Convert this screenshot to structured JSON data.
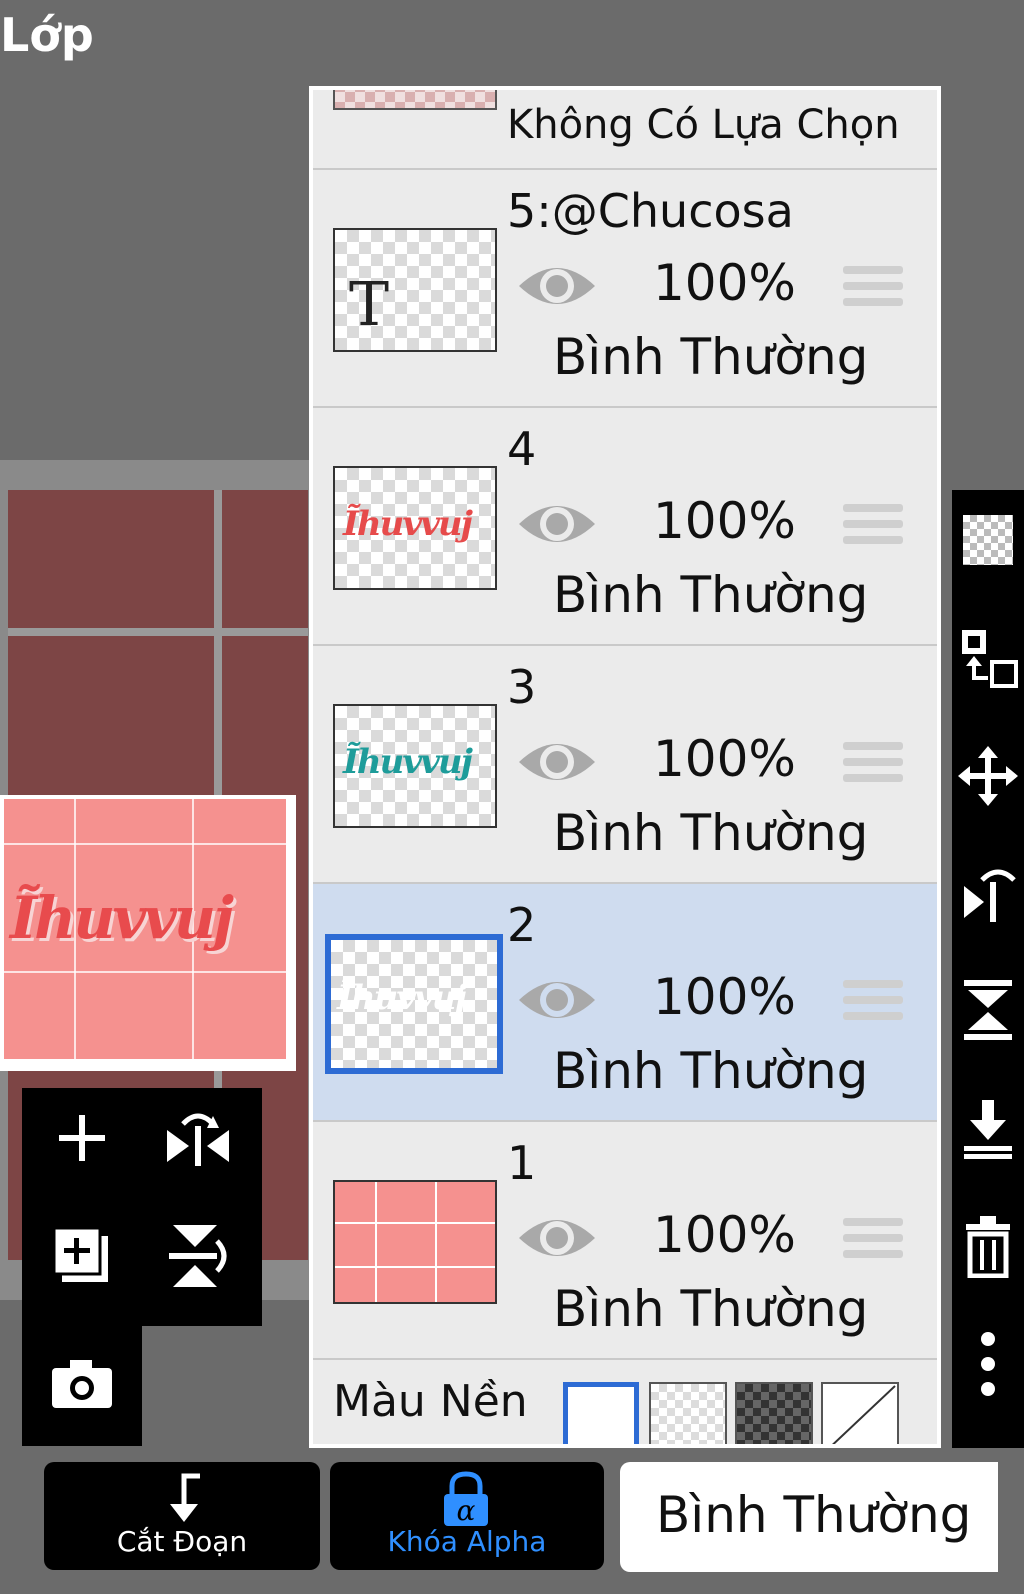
{
  "header": {
    "title": "Lớp"
  },
  "selection": {
    "label": "Không Có Lựa Chọn"
  },
  "layers": [
    {
      "number": "5:@Chucosa",
      "opacity": "100%",
      "blend": "Bình Thường",
      "thumb_text": "T"
    },
    {
      "number": "4",
      "opacity": "100%",
      "blend": "Bình Thường",
      "thumb_text": "Ĩhuvvuj"
    },
    {
      "number": "3",
      "opacity": "100%",
      "blend": "Bình Thường",
      "thumb_text": "Ĩhuvvuj"
    },
    {
      "number": "2",
      "opacity": "100%",
      "blend": "Bình Thường",
      "thumb_text": "Ĩhuvvuj",
      "selected": true
    },
    {
      "number": "1",
      "opacity": "100%",
      "blend": "Bình Thường",
      "thumb_text": ""
    }
  ],
  "background": {
    "label": "Màu Nền"
  },
  "preview": {
    "text": "Ĩhuvvuj"
  },
  "bottom": {
    "clip_label": "Cắt Đoạn",
    "alpha_lock_label": "Khóa Alpha",
    "blend_mode_label": "Bình Thường"
  },
  "colors": {
    "accent": "#2d6bd4",
    "alpha_lock": "#2f8fff",
    "selected_row": "#cfdcef",
    "canvas_pink": "#f5918f"
  }
}
